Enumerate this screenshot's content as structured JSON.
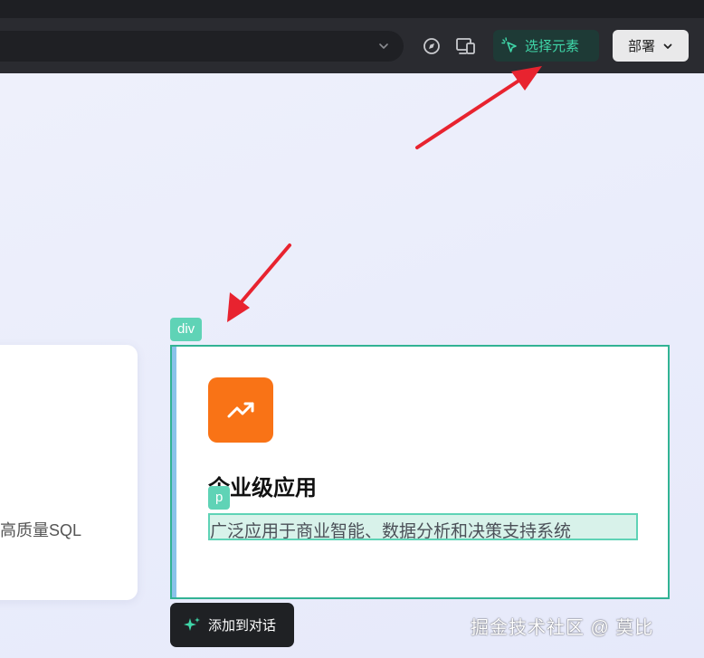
{
  "toolbar": {
    "select_label": "选择元素",
    "deploy_label": "部署",
    "icons": [
      "compass-icon",
      "device-preview-icon",
      "cursor-select-icon",
      "chevron-down-icon"
    ]
  },
  "cards": {
    "left_text": "高质量SQL",
    "main": {
      "div_tag": "div",
      "title": "企业级应用",
      "p_tag": "p",
      "description": "广泛应用于商业智能、数据分析和决策支持系统",
      "icon": "trending-up-icon",
      "icon_color": "#f97316"
    }
  },
  "add_button_label": "添加到对话",
  "watermark": "掘金技术社区 @ 莫比",
  "colors": {
    "accent": "#32b394",
    "tag": "#5fd3b6",
    "arrow": "#e8232f"
  }
}
